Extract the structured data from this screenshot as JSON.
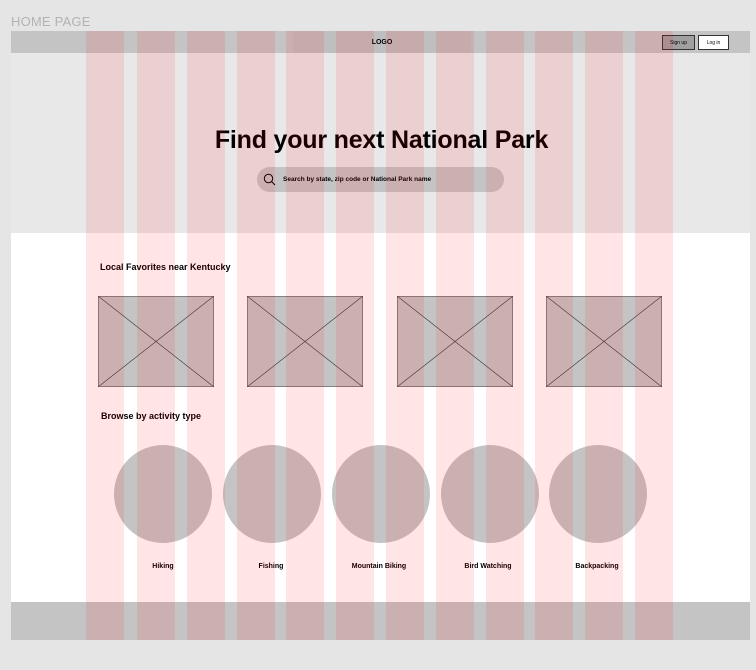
{
  "frame": {
    "label": "HOME PAGE"
  },
  "navbar": {
    "logo": "LOGO",
    "signup_label": "Sign up",
    "login_label": "Log in"
  },
  "hero": {
    "title": "Find your next National Park",
    "search_placeholder": "Search by state, zip code or National Park name",
    "search_icon": "search-icon"
  },
  "favorites": {
    "title": "Local Favorites near Kentucky",
    "card_count_note": ""
  },
  "activities": {
    "title": "Browse by activity type",
    "items": [
      {
        "label": "Hiking"
      },
      {
        "label": "Fishing"
      },
      {
        "label": "Mountain Biking"
      },
      {
        "label": "Bird Watching"
      },
      {
        "label": "Backpacking"
      }
    ]
  },
  "colors": {
    "frame_bg": "#ffffff",
    "hero_bg": "#e8e8e8",
    "placeholder_gray": "#c4c4c4",
    "signup_bg": "#a0a0a0",
    "layout_grid_overlay": "rgba(255,0,0,0.1)"
  }
}
